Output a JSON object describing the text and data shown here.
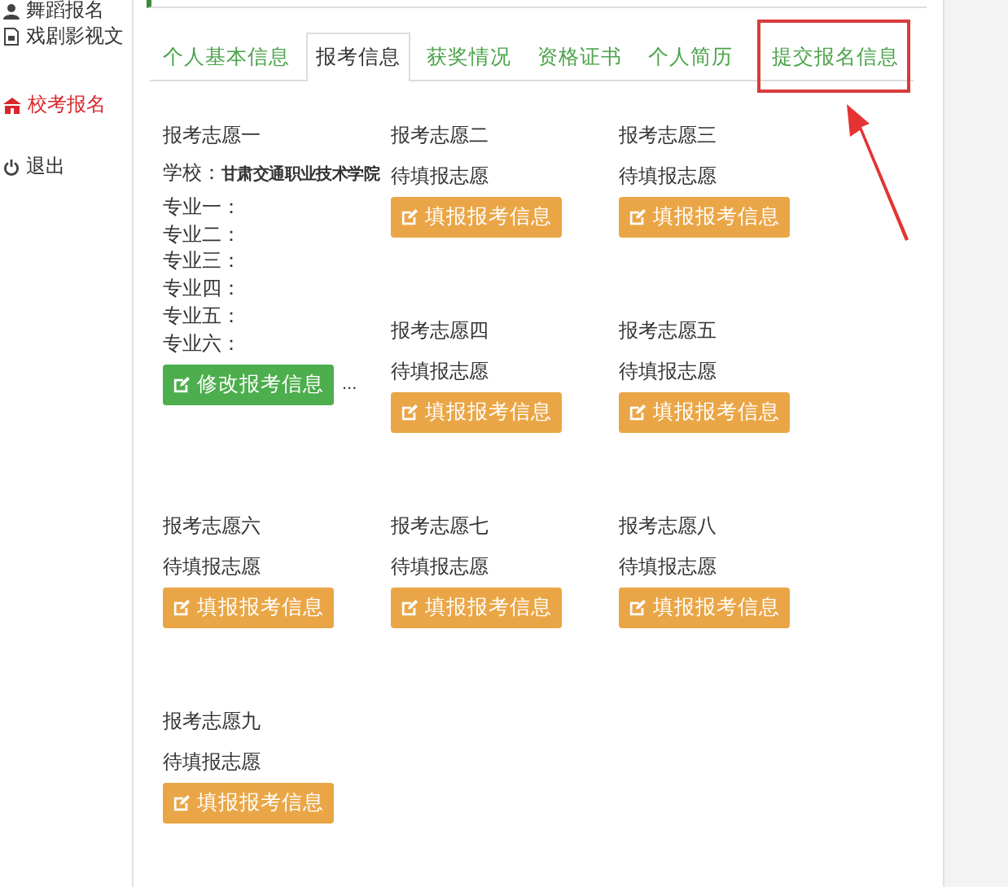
{
  "sidebar": {
    "items": [
      {
        "label": "舞蹈报名",
        "selected": false
      },
      {
        "label": "戏剧影视文",
        "selected": false
      },
      {
        "label": "校考报名",
        "selected": true
      },
      {
        "label": "退出",
        "selected": false
      }
    ]
  },
  "tabs": [
    {
      "label": "个人基本信息",
      "selected": false,
      "highlighted": false
    },
    {
      "label": "报考信息",
      "selected": true,
      "highlighted": false
    },
    {
      "label": "获奖情况",
      "selected": false,
      "highlighted": false
    },
    {
      "label": "资格证书",
      "selected": false,
      "highlighted": false
    },
    {
      "label": "个人简历",
      "selected": false,
      "highlighted": false
    },
    {
      "label": "提交报名信息",
      "selected": false,
      "highlighted": true
    }
  ],
  "choices": [
    {
      "title": "报考志愿一",
      "kind": "filled",
      "school_label": "学校：",
      "school": "甘肃交通职业技术学院",
      "majors": [
        "专业一：",
        "专业二：",
        "专业三：",
        "专业四：",
        "专业五：",
        "专业六："
      ],
      "button": "修改报考信息",
      "more": "..."
    },
    {
      "title": "报考志愿二",
      "kind": "pending",
      "status": "待填报志愿",
      "button": "填报报考信息"
    },
    {
      "title": "报考志愿三",
      "kind": "pending",
      "status": "待填报志愿",
      "button": "填报报考信息"
    },
    {
      "title": "报考志愿四",
      "kind": "pending",
      "status": "待填报志愿",
      "button": "填报报考信息"
    },
    {
      "title": "报考志愿五",
      "kind": "pending",
      "status": "待填报志愿",
      "button": "填报报考信息"
    },
    {
      "title": "报考志愿六",
      "kind": "pending",
      "status": "待填报志愿",
      "button": "填报报考信息"
    },
    {
      "title": "报考志愿七",
      "kind": "pending",
      "status": "待填报志愿",
      "button": "填报报考信息"
    },
    {
      "title": "报考志愿八",
      "kind": "pending",
      "status": "待填报志愿",
      "button": "填报报考信息"
    },
    {
      "title": "报考志愿九",
      "kind": "pending",
      "status": "待填报志愿",
      "button": "填报报考信息"
    }
  ]
}
